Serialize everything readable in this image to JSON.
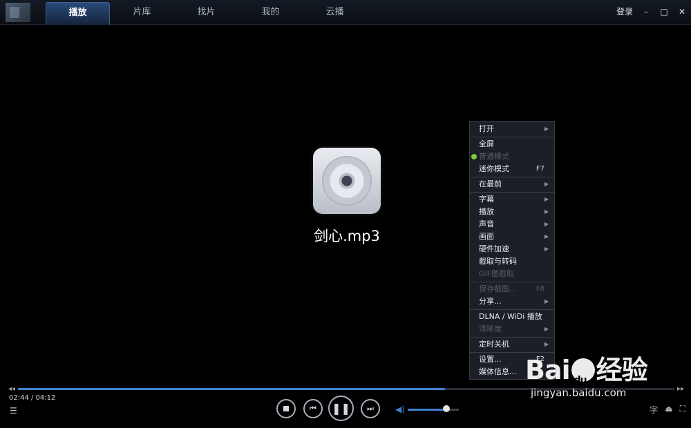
{
  "titlebar": {
    "tabs": [
      {
        "label": "播放",
        "active": true
      },
      {
        "label": "片库",
        "active": false
      },
      {
        "label": "找片",
        "active": false
      },
      {
        "label": "我的",
        "active": false
      },
      {
        "label": "云播",
        "active": false
      }
    ],
    "login_label": "登录",
    "minimize_symbol": "–",
    "maximize_symbol": "□",
    "close_symbol": "✕"
  },
  "media": {
    "title": "剑心.mp3",
    "icon": "cd-disc-icon"
  },
  "context_menu": {
    "items": [
      {
        "label": "打开",
        "submenu": true
      },
      {
        "separator": true
      },
      {
        "label": "全屏"
      },
      {
        "label": "普通模式",
        "disabled": true,
        "checked": true
      },
      {
        "label": "迷你模式",
        "shortcut": "F7"
      },
      {
        "separator": true
      },
      {
        "label": "在最前",
        "submenu": true
      },
      {
        "separator": true
      },
      {
        "label": "字幕",
        "submenu": true
      },
      {
        "label": "播放",
        "submenu": true
      },
      {
        "label": "声音",
        "submenu": true
      },
      {
        "label": "画面",
        "submenu": true
      },
      {
        "label": "硬件加速",
        "submenu": true
      },
      {
        "label": "截取与转码"
      },
      {
        "label": "GIF图截取",
        "disabled": true
      },
      {
        "separator": true
      },
      {
        "label": "保存截图...",
        "shortcut": "F8",
        "disabled": true
      },
      {
        "label": "分享...",
        "submenu": true
      },
      {
        "separator": true
      },
      {
        "label": "DLNA / WiDi 播放"
      },
      {
        "label": "清晰度",
        "submenu": true,
        "disabled": true
      },
      {
        "separator": true
      },
      {
        "label": "定时关机",
        "submenu": true
      },
      {
        "separator": true
      },
      {
        "label": "设置...",
        "shortcut": "F2"
      },
      {
        "label": "媒体信息..."
      }
    ]
  },
  "playback": {
    "time_display": "02:44 / 04:12",
    "progress_fraction": 0.65,
    "volume_fraction": 0.75,
    "seek_back_symbol": "◂◂",
    "seek_forward_symbol": "▸▸",
    "prev_symbol": "⏮",
    "play_pause_symbol": "❚❚",
    "next_symbol": "⏭",
    "volume_symbol": "◀)",
    "playlist_symbol": "☰"
  },
  "corner_icons": {
    "subtitle_symbol": "字",
    "eject_symbol": "⏏",
    "fullscreen_symbol": "⛶"
  },
  "watermark": {
    "logo_part1": "Bai",
    "logo_part2": "经验",
    "url": "jingyan.baidu.com"
  },
  "colors": {
    "accent": "#3f7fd0",
    "active_dot": "#7ccf3c"
  }
}
